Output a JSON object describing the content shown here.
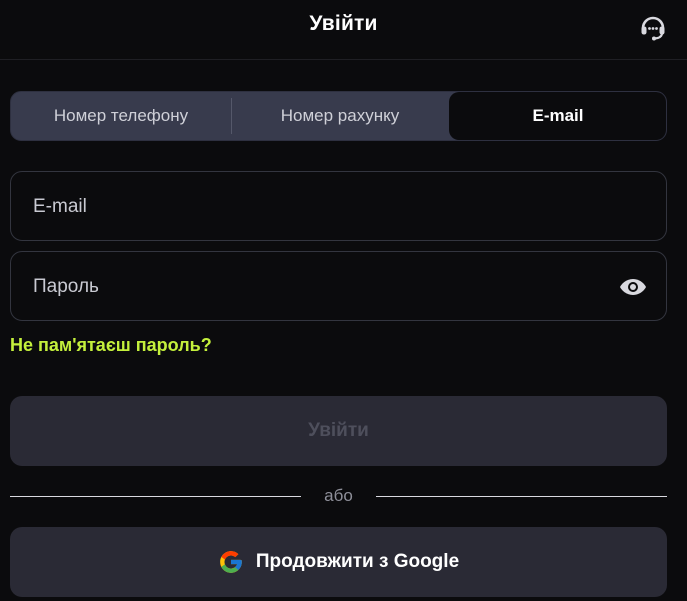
{
  "header": {
    "title": "Увійти",
    "support_icon": "headset-icon"
  },
  "tabs": [
    {
      "label": "Номер телефону",
      "active": false
    },
    {
      "label": "Номер рахунку",
      "active": false
    },
    {
      "label": "E-mail",
      "active": true
    }
  ],
  "form": {
    "email": {
      "value": "",
      "placeholder": "E-mail"
    },
    "password": {
      "value": "",
      "placeholder": "Пароль",
      "toggle_icon": "eye-icon"
    },
    "forgot_label": "Не пам'ятаєш пароль?",
    "submit_label": "Увійти"
  },
  "divider_label": "або",
  "google": {
    "label": "Продовжити з Google",
    "icon": "google-icon"
  },
  "colors": {
    "background": "#0b0b0d",
    "accent_link": "#c4f03c",
    "tab_bg": "#383b4d",
    "button_bg": "#2a2a35"
  }
}
